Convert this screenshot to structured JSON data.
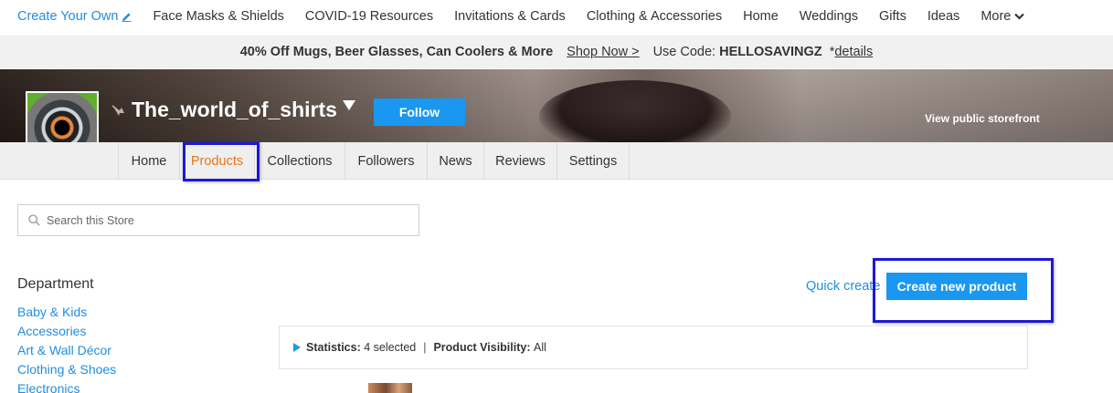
{
  "topnav": {
    "create_own": "Create Your Own",
    "items": [
      "Face Masks & Shields",
      "COVID-19 Resources",
      "Invitations & Cards",
      "Clothing & Accessories",
      "Home",
      "Weddings",
      "Gifts",
      "Ideas"
    ],
    "more": "More"
  },
  "promo": {
    "offer": "40% Off Mugs, Beer Glasses, Can Coolers & More",
    "shop_now": "Shop Now >",
    "code_prefix": "Use Code:",
    "code": "HELLOSAVINGZ",
    "asterisk": "*",
    "details": "details"
  },
  "store": {
    "name": "The_world_of_shirts",
    "follow": "Follow",
    "view_public": "View public storefront"
  },
  "tabs": [
    {
      "label": "Home",
      "active": false
    },
    {
      "label": "Products",
      "active": true
    },
    {
      "label": "Collections",
      "active": false
    },
    {
      "label": "Followers",
      "active": false
    },
    {
      "label": "News",
      "active": false
    },
    {
      "label": "Reviews",
      "active": false
    },
    {
      "label": "Settings",
      "active": false
    }
  ],
  "search": {
    "placeholder": "Search this Store"
  },
  "department": {
    "title": "Department",
    "items": [
      "Baby & Kids",
      "Accessories",
      "Art & Wall Décor",
      "Clothing & Shoes",
      "Electronics"
    ]
  },
  "actions": {
    "quick_create": "Quick create",
    "create_new": "Create new product"
  },
  "stats": {
    "statistics_label": "Statistics:",
    "statistics_value": "4 selected",
    "separator": "|",
    "visibility_label": "Product Visibility:",
    "visibility_value": "All"
  },
  "colors": {
    "link_blue": "#1f8de0",
    "button_blue": "#1a97f0",
    "active_tab": "#e8741c",
    "highlight_box": "#1c19d4"
  },
  "icons": {
    "edit": "pencil-icon",
    "more": "chevron-down-icon",
    "search": "search-icon",
    "pin": "pin-icon"
  }
}
